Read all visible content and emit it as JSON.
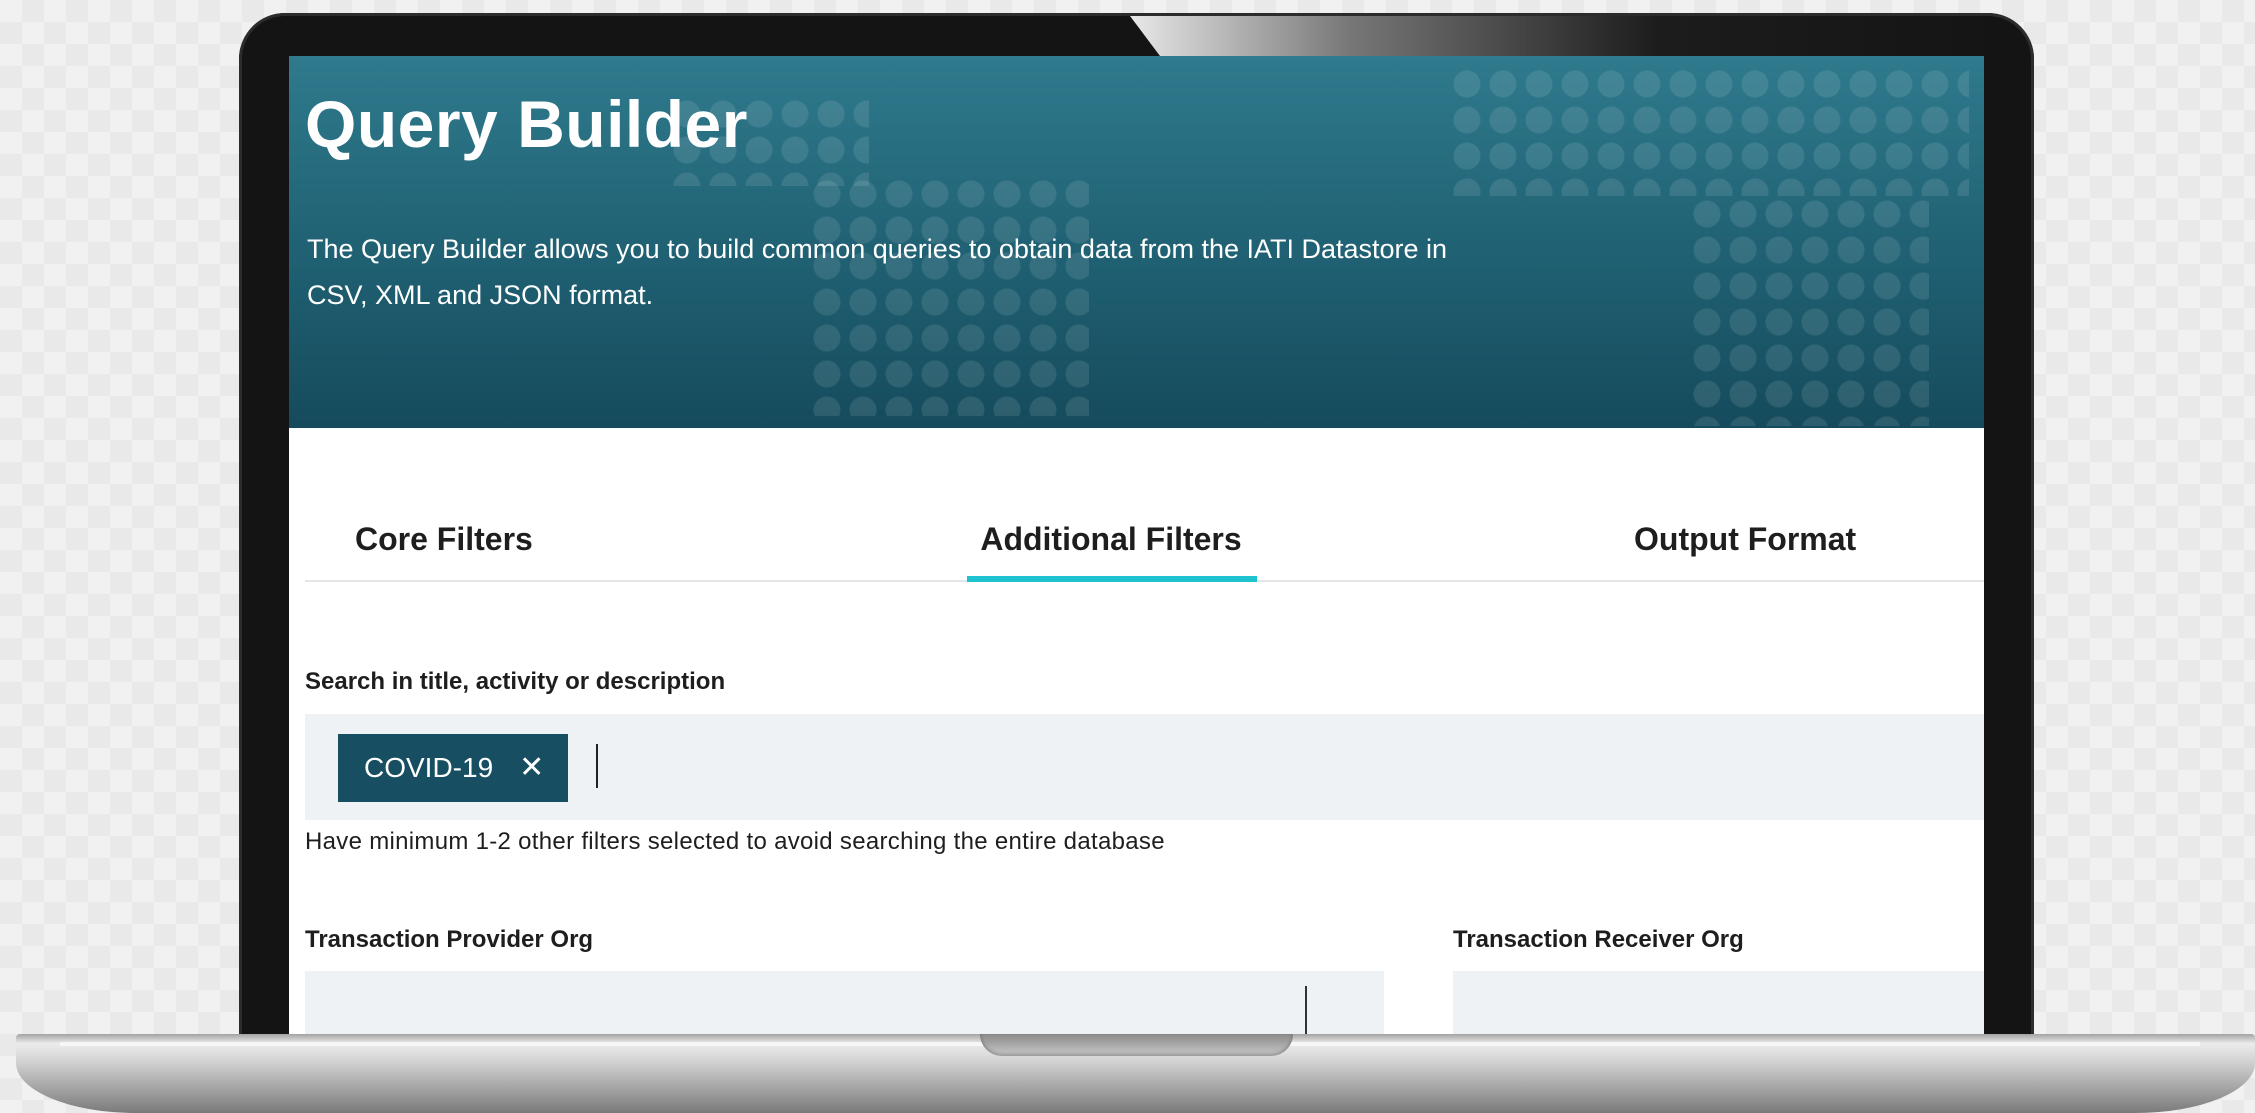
{
  "hero": {
    "title": "Query Builder",
    "description": "The Query Builder allows you to build common queries to obtain data from the IATI Datastore in CSV, XML and JSON format."
  },
  "tabs": [
    {
      "label": "Core Filters",
      "active": false
    },
    {
      "label": "Additional Filters",
      "active": true
    },
    {
      "label": "Output Format",
      "active": false
    }
  ],
  "search": {
    "label": "Search in title, activity or description",
    "chip": "COVID-19",
    "chip_close_icon": "close-icon",
    "hint": "Have minimum 1-2 other filters selected to avoid searching the entire database"
  },
  "filters": {
    "provider_label": "Transaction Provider Org",
    "receiver_label": "Transaction Receiver Org"
  },
  "colors": {
    "hero": "#1f6072",
    "chip": "#184e61",
    "accent": "#1fc3cf",
    "field_bg": "#eef2f5"
  }
}
